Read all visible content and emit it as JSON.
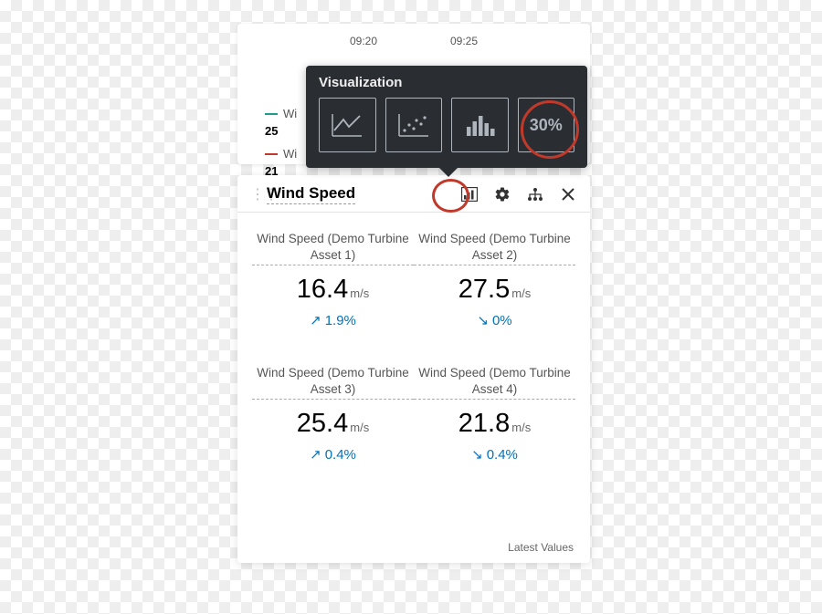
{
  "timeAxis": {
    "t1": "09:20",
    "t2": "09:25"
  },
  "legend": {
    "row1": {
      "label": "Wi",
      "val": "25",
      "color": "#1f9d8b"
    },
    "row2": {
      "label": "Wi",
      "val": "21",
      "color": "#c0392b"
    }
  },
  "popover": {
    "title": "Visualization",
    "kpiLabel": "30%"
  },
  "card": {
    "title": "Wind Speed",
    "footer": "Latest Values"
  },
  "metrics": [
    {
      "label": "Wind Speed (Demo Turbine Asset 1)",
      "value": "16.4",
      "unit": "m/s",
      "trend": "1.9%",
      "dir": "up"
    },
    {
      "label": "Wind Speed (Demo Turbine Asset 2)",
      "value": "27.5",
      "unit": "m/s",
      "trend": "0%",
      "dir": "down"
    },
    {
      "label": "Wind Speed (Demo Turbine Asset 3)",
      "value": "25.4",
      "unit": "m/s",
      "trend": "0.4%",
      "dir": "up"
    },
    {
      "label": "Wind Speed (Demo Turbine Asset 4)",
      "value": "21.8",
      "unit": "m/s",
      "trend": "0.4%",
      "dir": "down"
    }
  ]
}
